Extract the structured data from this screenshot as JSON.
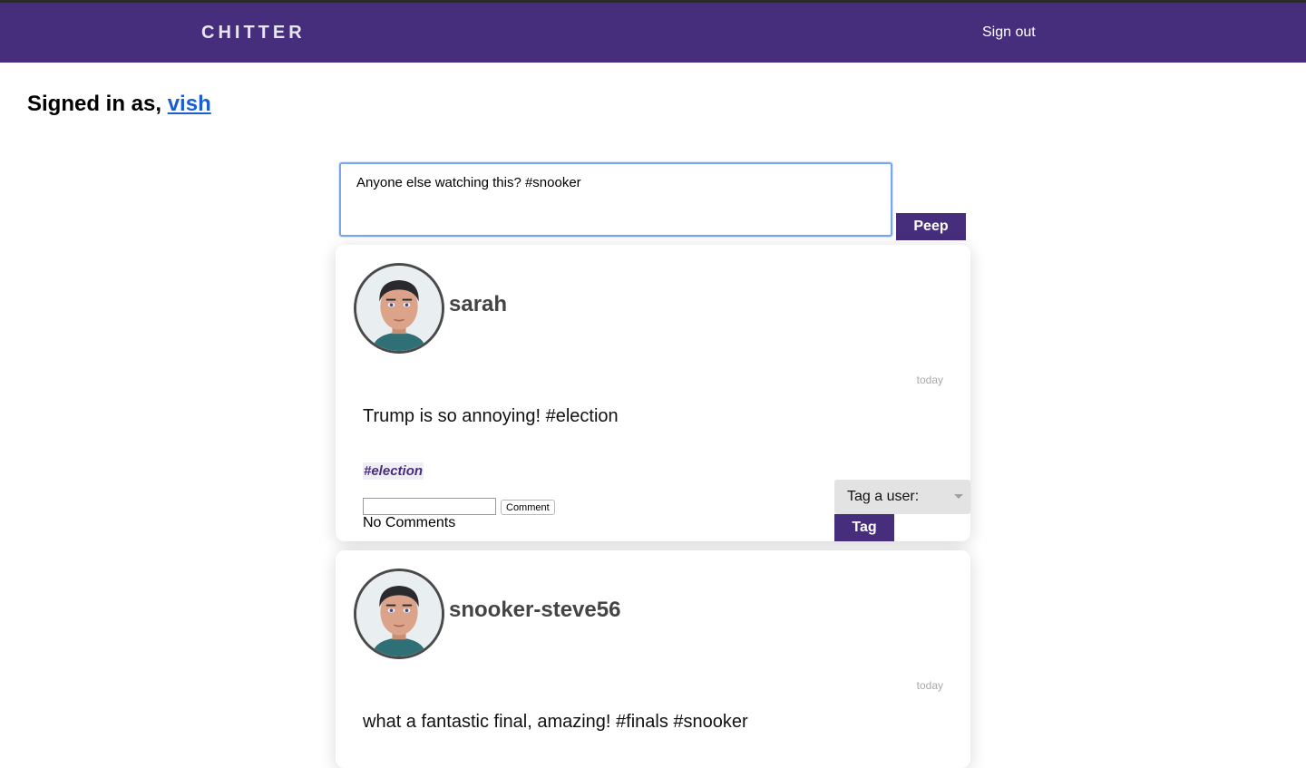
{
  "nav": {
    "brand": "CHITTER",
    "signout": "Sign out"
  },
  "session": {
    "prefix": "Signed in as, ",
    "username": "vish"
  },
  "composer": {
    "value": "Anyone else watching this? #snooker",
    "submit_label": "Peep"
  },
  "colors": {
    "brand": "#462e7c",
    "link": "#1a5fd1"
  },
  "peeps": [
    {
      "author": "sarah",
      "time": "today",
      "text": "Trump is so annoying! #election",
      "hashtag": "#election",
      "comment_button": "Comment",
      "comments_status": "No Comments",
      "tag_label": "Tag a user:",
      "tag_button": "Tag"
    },
    {
      "author": "snooker-steve56",
      "time": "today",
      "text": "what a fantastic final, amazing! #finals #snooker"
    }
  ]
}
